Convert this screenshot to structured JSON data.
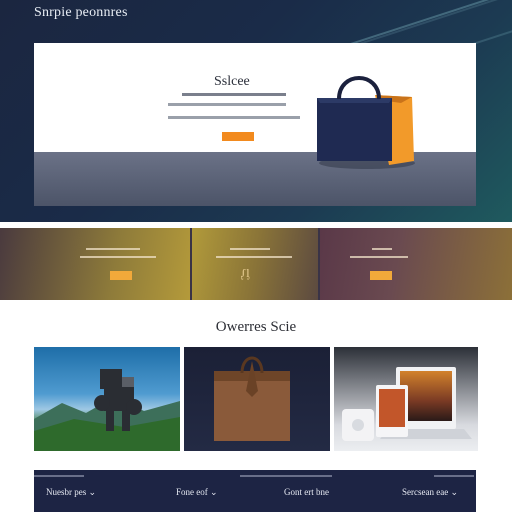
{
  "header": {
    "site_title": "Snrpie peonnres"
  },
  "hero": {
    "title": "Sslcee"
  },
  "section": {
    "heading": "Owerres Scie"
  },
  "nav": {
    "items": [
      {
        "label": "Nuesbr pes",
        "chevron": "chevron-down-icon"
      },
      {
        "label": "Fone eof",
        "chevron": "chevron-down-icon"
      },
      {
        "label": "Gont ert bne",
        "chevron": ""
      },
      {
        "label": "Sercsean eae",
        "chevron": "chevron-down-icon"
      }
    ]
  },
  "colors": {
    "accent_orange": "#f28a1e",
    "navy": "#1d2444",
    "promo_gold": "#9a8a3a",
    "promo_plum": "#4a3348"
  },
  "icons": {
    "bag": "shopping-bag-icon",
    "leather_bag": "leather-bag-icon",
    "device_group": "devices-icon"
  }
}
